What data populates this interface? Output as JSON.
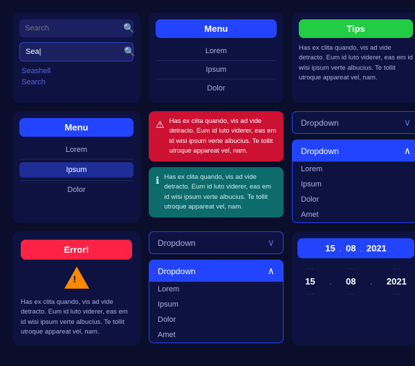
{
  "search": {
    "placeholder": "Search",
    "active_value": "Sea|",
    "results": [
      "Seashell",
      "Search"
    ]
  },
  "menu_top": {
    "header": "Menu",
    "items": [
      "Lorem",
      "Ipsum",
      "Dolor"
    ]
  },
  "tips": {
    "header": "Tips",
    "text": "Has ex clita quando, vis ad vide detracto. Eum id luto viderer, eas em id wisi ipsum verte albucius. Te tollit utroque appareat vel, nam."
  },
  "menu_left": {
    "header": "Menu",
    "items": [
      "Lorem",
      "Ipsum",
      "Dolor"
    ],
    "selected_index": 1
  },
  "alert_red": {
    "icon": "⚠",
    "text": "Has ex clita quando, vis ad vide detracto. Eum id luto viderer, eas em id wisi ipsum verte albucius. Te tollit utroque appareat vel, nam."
  },
  "alert_teal": {
    "icon": "ℹ",
    "text": "Has ex clita quando, vis ad vide detracto. Eum id luto viderer, eas em id wisi ipsum verte albucius. Te tollit utroque appareat vel, nam."
  },
  "dropdown_collapsed_top": {
    "label": "Dropdown",
    "chevron": "∨"
  },
  "dropdown_open_right": {
    "label": "Dropdown",
    "chevron": "∧",
    "options": [
      "Lorem",
      "Ipsum",
      "Dolor",
      "Amet"
    ]
  },
  "dropdown_collapsed_mid": {
    "label": "Dropdown",
    "chevron": "∨"
  },
  "dropdown_open_bottom": {
    "label": "Dropdown",
    "chevron": "∧",
    "options": [
      "Lorem",
      "Ipsum",
      "Dolor",
      "Amet"
    ]
  },
  "error": {
    "header": "Error!",
    "text": "Has ex clita quando, vis ad vide detracto. Eum id luto viderer, eas em id wisi ipsum verte albucius. Te tollit utroque appareat vel, nam."
  },
  "date_picker": {
    "header_day": "15",
    "header_dot1": ".",
    "header_month": "08",
    "header_dot2": ".",
    "header_year": "2021",
    "day_above": "...",
    "day_val": "15",
    "day_below": "...",
    "month_above": "...",
    "month_val": "08",
    "month_below": "...",
    "year_above": "...",
    "year_val": "2021",
    "year_below": "..."
  }
}
